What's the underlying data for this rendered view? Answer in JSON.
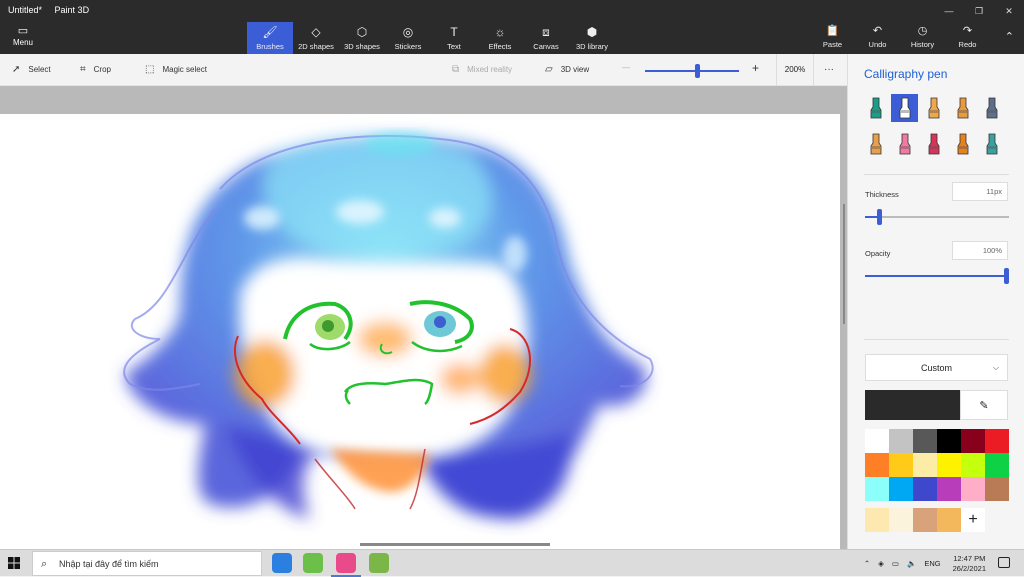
{
  "window": {
    "title": "Untitled*",
    "app_name": "Paint 3D",
    "controls": [
      "—",
      "❐",
      "✕"
    ]
  },
  "menu": {
    "label": "Menu",
    "icon": "folder-icon"
  },
  "tools": [
    {
      "label": "Brushes",
      "icon": "brush-icon",
      "active": true
    },
    {
      "label": "2D shapes",
      "icon": "shapes-2d-icon"
    },
    {
      "label": "3D shapes",
      "icon": "cube-icon"
    },
    {
      "label": "Stickers",
      "icon": "sticker-icon"
    },
    {
      "label": "Text",
      "icon": "text-icon"
    },
    {
      "label": "Effects",
      "icon": "effects-icon"
    },
    {
      "label": "Canvas",
      "icon": "canvas-icon"
    },
    {
      "label": "3D library",
      "icon": "library-icon"
    }
  ],
  "actions": [
    {
      "label": "Paste",
      "icon": "paste-icon"
    },
    {
      "label": "Undo",
      "icon": "undo-icon"
    },
    {
      "label": "History",
      "icon": "history-icon"
    },
    {
      "label": "Redo",
      "icon": "redo-icon"
    }
  ],
  "subbar": {
    "select": "Select",
    "crop": "Crop",
    "magic_select": "Magic select",
    "mixed_reality": "Mixed reality",
    "view_3d": "3D view",
    "zoom_minus": "—",
    "zoom_plus": "+",
    "zoom_value": "200%",
    "zoom_level": 0.55,
    "more": "···"
  },
  "panel": {
    "title": "Calligraphy pen",
    "brushes": [
      {
        "name": "marker",
        "color": "#1a9e8a"
      },
      {
        "name": "calligraphy-pen",
        "color": "#ffffff",
        "active": true
      },
      {
        "name": "oil-brush",
        "color": "#f0a64a"
      },
      {
        "name": "watercolor",
        "color": "#e89a3c"
      },
      {
        "name": "pixel-pen",
        "color": "#5e6f8c"
      },
      {
        "name": "pencil",
        "color": "#e8a04a"
      },
      {
        "name": "eraser",
        "color": "#f07aa0"
      },
      {
        "name": "crayon",
        "color": "#d8345a"
      },
      {
        "name": "spray-can",
        "color": "#e8801e"
      },
      {
        "name": "fill",
        "color": "#3aa0a0"
      }
    ],
    "thickness_label": "Thickness",
    "thickness_value": "11px",
    "thickness_level": 0.1,
    "opacity_label": "Opacity",
    "opacity_value": "100%",
    "opacity_level": 1.0,
    "color_mode": "Custom",
    "current_color": "#2a2a2a",
    "palette": [
      "#ffffff",
      "#c3c3c3",
      "#585858",
      "#000000",
      "#88001b",
      "#ec1c24",
      "#ff7f27",
      "#ffca18",
      "#fdeca6",
      "#fff200",
      "#c4ff0e",
      "#0ed145",
      "#8cfffb",
      "#00a8f3",
      "#3f48cc",
      "#b83dba",
      "#ffaec8",
      "#b97a56"
    ],
    "custom_palette": [
      "#fde8b0",
      "#fcf3dc",
      "#d8a27a",
      "#f4b85c"
    ],
    "add_color": "+"
  },
  "taskbar": {
    "search_placeholder": "Nhập tại đây để tìm kiếm",
    "apps": [
      {
        "name": "zalo",
        "color": "#2a7fe0"
      },
      {
        "name": "app-green",
        "color": "#6cc04a"
      },
      {
        "name": "paint-3d",
        "color": "#e94b8a"
      },
      {
        "name": "bluestacks",
        "color": "#7ab648"
      }
    ],
    "language": "ENG",
    "time": "12:47 PM",
    "date": "26/2/2021"
  }
}
